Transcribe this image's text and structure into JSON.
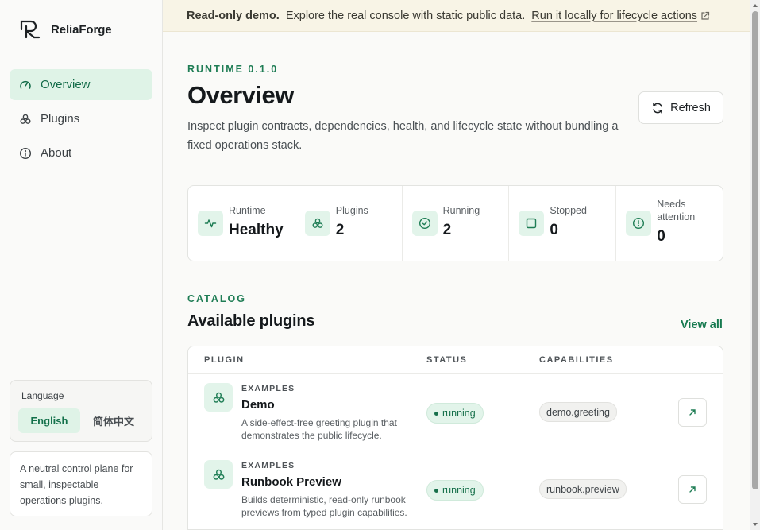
{
  "brand": {
    "name": "ReliaForge"
  },
  "nav": [
    {
      "label": "Overview",
      "icon": "gauge-icon",
      "active": true
    },
    {
      "label": "Plugins",
      "icon": "plugins-icon",
      "active": false
    },
    {
      "label": "About",
      "icon": "info-icon",
      "active": false
    }
  ],
  "language": {
    "title": "Language",
    "english": "English",
    "chinese": "简体中文",
    "selected": "English"
  },
  "tagline": "A neutral control plane for small, inspectable operations plugins.",
  "banner": {
    "strong": "Read-only demo.",
    "text": "Explore the real console with static public data.",
    "link": "Run it locally for lifecycle actions"
  },
  "header": {
    "eyebrow": "RUNTIME 0.1.0",
    "title": "Overview",
    "description": "Inspect plugin contracts, dependencies, health, and lifecycle state without bundling a fixed operations stack.",
    "refresh": "Refresh"
  },
  "stats": [
    {
      "label": "Runtime",
      "value": "Healthy",
      "icon": "activity-icon"
    },
    {
      "label": "Plugins",
      "value": "2",
      "icon": "plugins-icon"
    },
    {
      "label": "Running",
      "value": "2",
      "icon": "check-circle-icon"
    },
    {
      "label": "Stopped",
      "value": "0",
      "icon": "square-icon"
    },
    {
      "label": "Needs attention",
      "value": "0",
      "icon": "alert-circle-icon"
    }
  ],
  "catalog": {
    "eyebrow": "CATALOG",
    "title": "Available plugins",
    "view_all": "View all",
    "columns": [
      "PLUGIN",
      "STATUS",
      "CAPABILITIES"
    ],
    "rows": [
      {
        "category": "EXAMPLES",
        "name": "Demo",
        "description": "A side-effect-free greeting plugin that demonstrates the public lifecycle.",
        "status": "running",
        "capability": "demo.greeting"
      },
      {
        "category": "EXAMPLES",
        "name": "Runbook Preview",
        "description": "Builds deterministic, read-only runbook previews from typed plugin capabilities.",
        "status": "running",
        "capability": "runbook.preview"
      }
    ]
  },
  "colors": {
    "accent": "#1f7d55",
    "accent_bg": "#dff3e7",
    "banner_bg": "#f8f4e6"
  }
}
